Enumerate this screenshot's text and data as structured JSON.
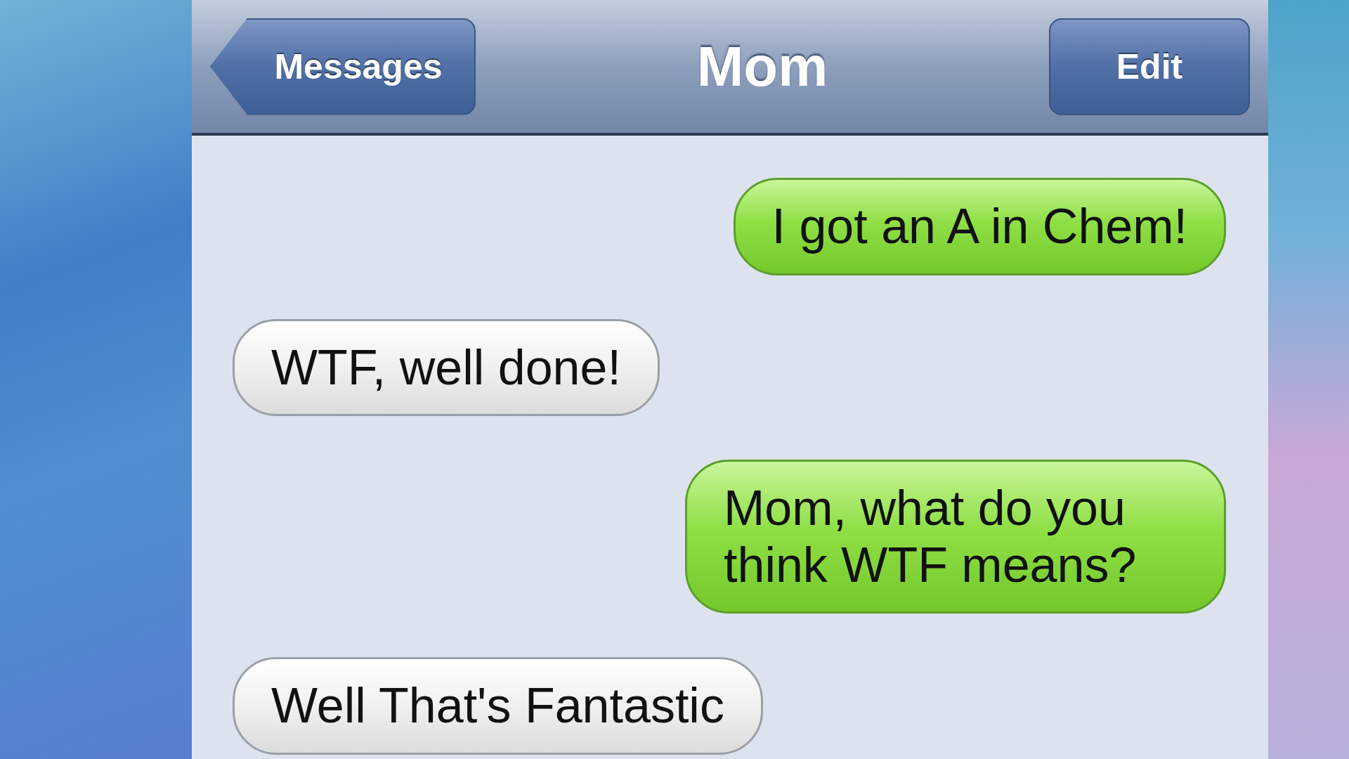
{
  "nav_bar": {
    "back_button": "Messages",
    "title": "Mom",
    "edit_button": "Edit"
  },
  "messages": [
    {
      "kind": "sent",
      "text": "I got an A in Chem!"
    },
    {
      "kind": "received",
      "text": "WTF, well done!"
    },
    {
      "kind": "sent",
      "text": "Mom, what do you think WTF means?"
    },
    {
      "kind": "received",
      "text": "Well That's Fantastic"
    }
  ]
}
